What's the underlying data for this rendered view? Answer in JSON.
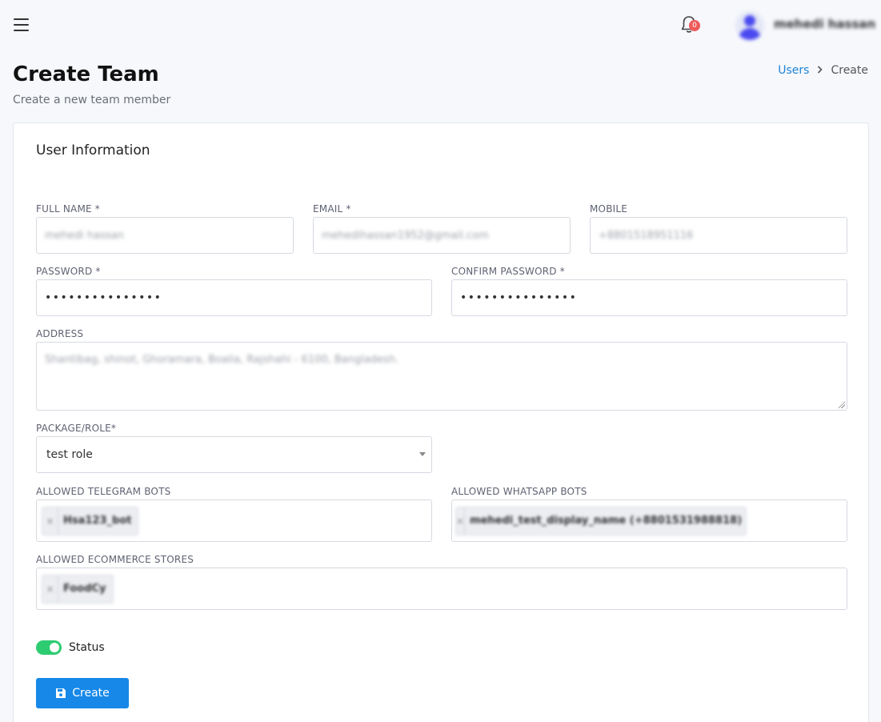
{
  "header": {
    "notification_count": "0",
    "user_name": "mehedi hassan"
  },
  "page": {
    "title": "Create Team",
    "subtitle": "Create a new team member"
  },
  "breadcrumb": {
    "parent": "Users",
    "current": "Create"
  },
  "form": {
    "section_title": "User Information",
    "full_name": {
      "label": "FULL NAME *",
      "value": "mehedi hassan"
    },
    "email": {
      "label": "EMAIL *",
      "value": "mehedihassan1952@gmail.com"
    },
    "mobile": {
      "label": "MOBILE",
      "value": "+8801518951116"
    },
    "password": {
      "label": "PASSWORD *",
      "value": "•••••••••••••••"
    },
    "confirm_password": {
      "label": "CONFIRM PASSWORD *",
      "value": "•••••••••••••••"
    },
    "address": {
      "label": "ADDRESS",
      "value": "Shantibag, shinot, Ghoramara, Boalia, Rajshahi - 6100, Bangladesh."
    },
    "package_role": {
      "label": "PACKAGE/ROLE*",
      "value": "test role"
    },
    "telegram_bots": {
      "label": "ALLOWED TELEGRAM BOTS",
      "tags": [
        "Hsa123_bot"
      ]
    },
    "whatsapp_bots": {
      "label": "ALLOWED WHATSAPP BOTS",
      "tags": [
        "mehedi_test_display_name (+8801531988818)"
      ]
    },
    "ecommerce_stores": {
      "label": "ALLOWED ECOMMERCE STORES",
      "tags": [
        "FoodCy"
      ]
    },
    "status": {
      "label": "Status",
      "enabled": true
    },
    "submit_label": "Create"
  },
  "colors": {
    "accent": "#1788e8",
    "toggle_on": "#2ecc71",
    "badge": "#ee5a5a",
    "link": "#1f83d6"
  }
}
